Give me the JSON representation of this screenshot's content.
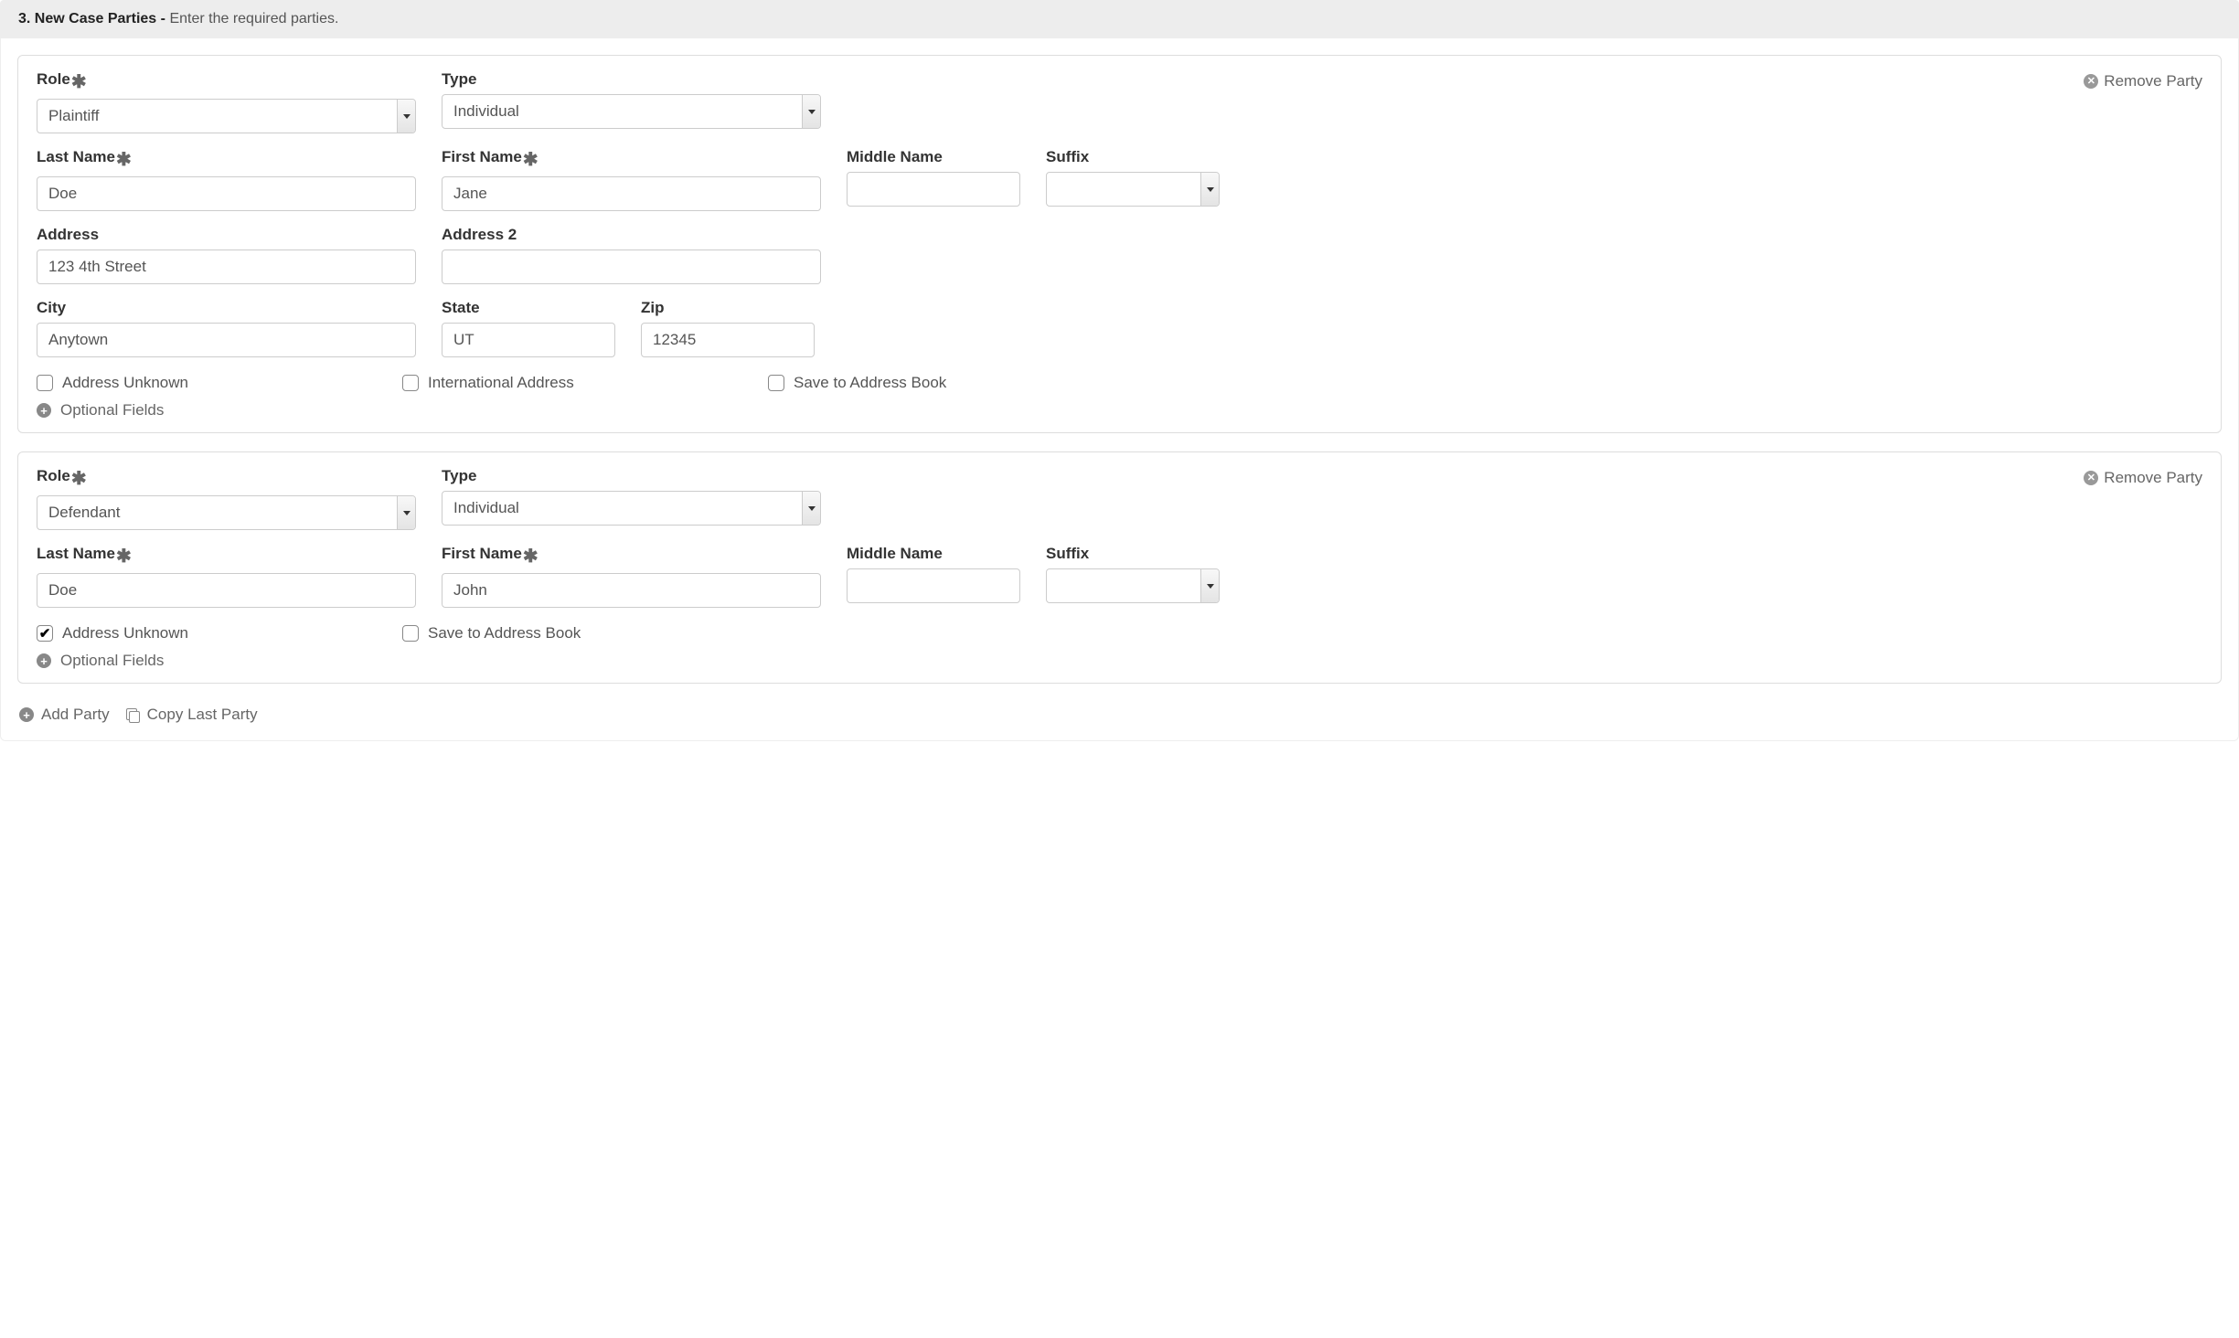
{
  "header": {
    "step_num": "3.",
    "title": "New Case Parties -",
    "subtitle": "Enter the required parties."
  },
  "labels": {
    "role": "Role",
    "type": "Type",
    "last_name": "Last Name",
    "first_name": "First Name",
    "middle_name": "Middle Name",
    "suffix": "Suffix",
    "address": "Address",
    "address2": "Address 2",
    "city": "City",
    "state": "State",
    "zip": "Zip",
    "remove_party": "Remove Party",
    "address_unknown": "Address Unknown",
    "international_address": "International Address",
    "save_to_address_book": "Save to Address Book",
    "optional_fields": "Optional Fields",
    "add_party": "Add Party",
    "copy_last_party": "Copy Last Party"
  },
  "parties": [
    {
      "role": "Plaintiff",
      "type": "Individual",
      "last_name": "Doe",
      "first_name": "Jane",
      "middle_name": "",
      "suffix": "",
      "address": "123 4th Street",
      "address2": "",
      "city": "Anytown",
      "state": "UT",
      "zip": "12345",
      "address_unknown": false,
      "international_address": false,
      "save_to_address_book": false,
      "show_address": true
    },
    {
      "role": "Defendant",
      "type": "Individual",
      "last_name": "Doe",
      "first_name": "John",
      "middle_name": "",
      "suffix": "",
      "address_unknown": true,
      "save_to_address_book": false,
      "show_address": false
    }
  ]
}
